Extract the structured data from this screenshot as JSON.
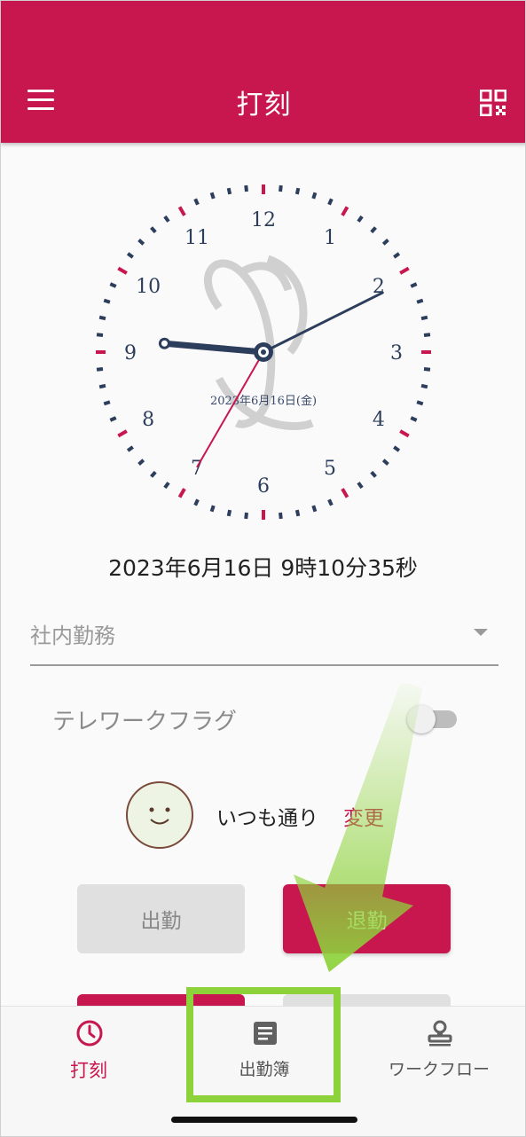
{
  "header": {
    "title": "打刻",
    "menu_icon": "hamburger-menu-icon",
    "qr_icon": "qr-code-icon",
    "bg_color": "#c8174f"
  },
  "clock": {
    "numerals": [
      "12",
      "1",
      "2",
      "3",
      "4",
      "5",
      "6",
      "7",
      "8",
      "9",
      "10",
      "11"
    ],
    "date_label": "2023年6月16日(金)",
    "time": {
      "hour": 9,
      "minute": 10,
      "second": 35
    }
  },
  "datetime_text": "2023年6月16日 9時10分35秒",
  "work_type": {
    "value": "社内勤務"
  },
  "telework": {
    "label": "テレワークフラグ",
    "enabled": false
  },
  "mood": {
    "text": "いつも通り",
    "change_label": "変更"
  },
  "buttons": {
    "clock_in": "出勤",
    "clock_out": "退勤"
  },
  "nav": {
    "items": [
      {
        "label": "打刻",
        "icon": "clock-icon",
        "active": true
      },
      {
        "label": "出勤簿",
        "icon": "document-icon",
        "active": false
      },
      {
        "label": "ワークフロー",
        "icon": "stamp-icon",
        "active": false
      }
    ]
  }
}
